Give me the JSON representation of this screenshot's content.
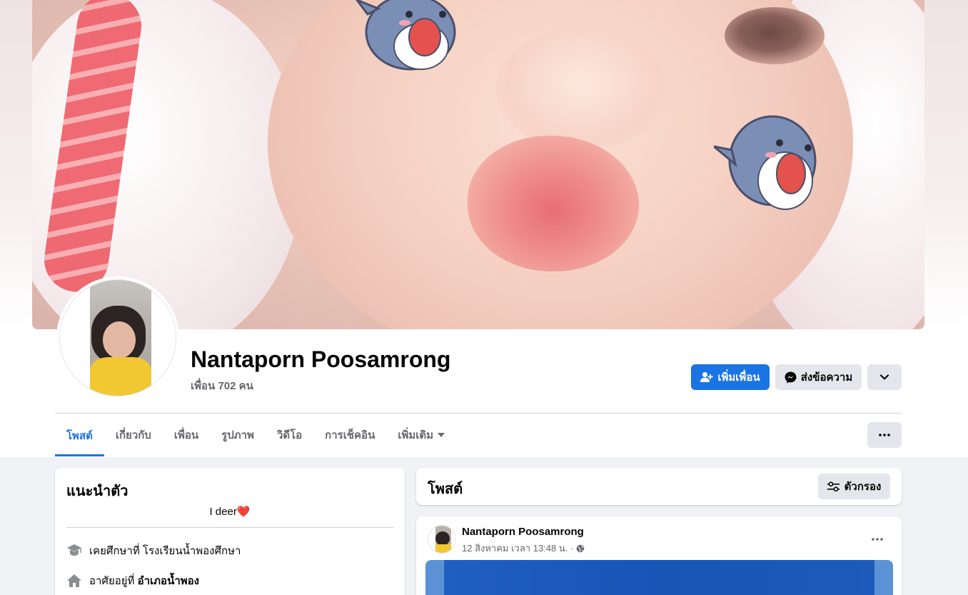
{
  "profile": {
    "name": "Nantaporn Poosamrong",
    "friends_count": "เพื่อน 702 คน"
  },
  "actions": {
    "add_friend_label": "เพิ่มเพื่อน",
    "message_label": "ส่งข้อความ",
    "add_friend_icon": "add-person-icon",
    "message_icon": "messenger-icon",
    "more_icon": "chevron-down-icon"
  },
  "tabs": [
    {
      "label": "โพสต์",
      "active": true
    },
    {
      "label": "เกี่ยวกับ",
      "active": false
    },
    {
      "label": "เพื่อน",
      "active": false
    },
    {
      "label": "รูปภาพ",
      "active": false
    },
    {
      "label": "วิดีโอ",
      "active": false
    },
    {
      "label": "การเช็คอิน",
      "active": false
    },
    {
      "label": "เพิ่มเติม",
      "active": false
    }
  ],
  "intro": {
    "title": "แนะนำตัว",
    "bio_text": "I deer",
    "bio_emoji": "❤️",
    "education_prefix": "เคยศึกษาที่ ",
    "education_value": "โรงเรียนน้ำพองศึกษา",
    "lives_prefix": "อาศัยอยู่ที่ ",
    "lives_value": "อำเภอน้ำพอง"
  },
  "posts_section": {
    "title": "โพสต์",
    "filter_label": "ตัวกรอง",
    "filter_icon": "sliders-icon"
  },
  "post": {
    "author": "Nantaporn Poosamrong",
    "timestamp": "12 สิงหาคม เวลา 13:48 น. ·",
    "privacy_icon": "globe-icon"
  },
  "colors": {
    "accent": "#1b74e4",
    "secondary_button": "#e4e6eb",
    "page_background": "#f0f2f5",
    "muted_text": "#65676b"
  }
}
